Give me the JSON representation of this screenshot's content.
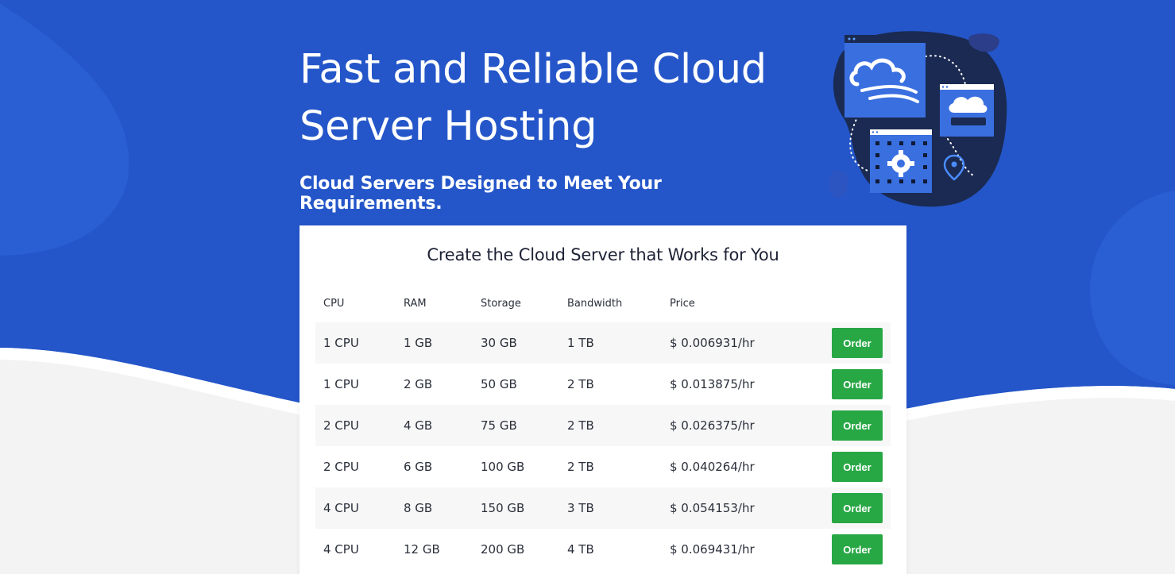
{
  "hero": {
    "title_line1": "Fast and Reliable Cloud",
    "title_line2": "Server Hosting",
    "subtitle": "Cloud Servers Designed to Meet Your Requirements."
  },
  "colors": {
    "hero_blue": "#2456c9",
    "page_bg": "#f3f3f3",
    "order_green": "#28a745"
  },
  "illustration": {
    "icons": [
      "cloud-window-icon",
      "cloud-storage-icon",
      "gear-grid-icon",
      "location-pin-icon"
    ]
  },
  "pricing": {
    "title": "Create the Cloud Server that Works for You",
    "headers": {
      "cpu": "CPU",
      "ram": "RAM",
      "storage": "Storage",
      "bandwidth": "Bandwidth",
      "price": "Price"
    },
    "order_label": "Order",
    "rows": [
      {
        "cpu": "1 CPU",
        "ram": "1 GB",
        "storage": "30 GB",
        "bandwidth": "1 TB",
        "price": "$ 0.006931/hr"
      },
      {
        "cpu": "1 CPU",
        "ram": "2 GB",
        "storage": "50 GB",
        "bandwidth": "2 TB",
        "price": "$ 0.013875/hr"
      },
      {
        "cpu": "2 CPU",
        "ram": "4 GB",
        "storage": "75 GB",
        "bandwidth": "2 TB",
        "price": "$ 0.026375/hr"
      },
      {
        "cpu": "2 CPU",
        "ram": "6 GB",
        "storage": "100 GB",
        "bandwidth": "2 TB",
        "price": "$ 0.040264/hr"
      },
      {
        "cpu": "4 CPU",
        "ram": "8 GB",
        "storage": "150 GB",
        "bandwidth": "3 TB",
        "price": "$ 0.054153/hr"
      },
      {
        "cpu": "4 CPU",
        "ram": "12 GB",
        "storage": "200 GB",
        "bandwidth": "4 TB",
        "price": "$ 0.069431/hr"
      }
    ]
  }
}
